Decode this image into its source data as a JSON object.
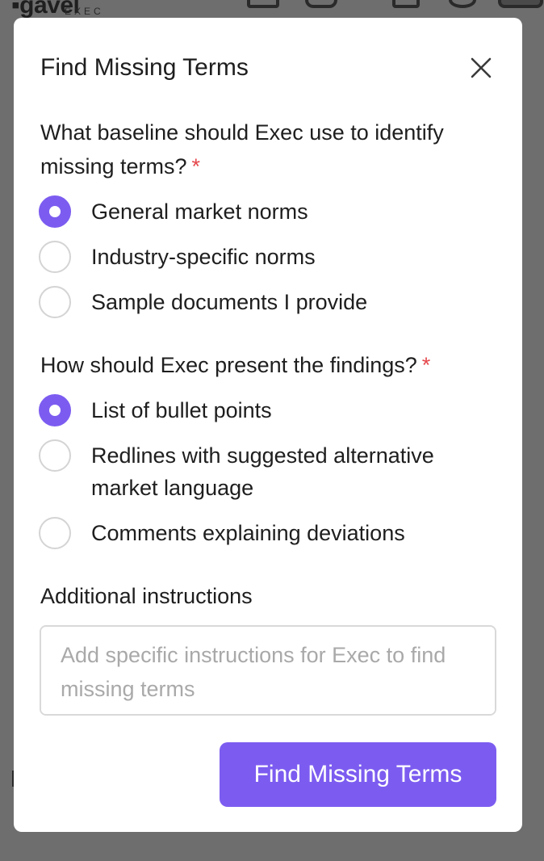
{
  "background": {
    "logo_text": "▪gavel",
    "logo_subtext": "EXEC"
  },
  "modal": {
    "title": "Find Missing Terms",
    "close_icon": "close-icon",
    "required_marker": "*",
    "question_baseline": {
      "label": "What baseline should Exec use to identify missing terms?",
      "options": [
        {
          "label": "General market norms",
          "selected": true
        },
        {
          "label": "Industry-specific norms",
          "selected": false
        },
        {
          "label": "Sample documents I provide",
          "selected": false
        }
      ]
    },
    "question_presentation": {
      "label": "How should Exec present the findings?",
      "options": [
        {
          "label": "List of bullet points",
          "selected": true
        },
        {
          "label": "Redlines with suggested alternative market language",
          "selected": false
        },
        {
          "label": "Comments explaining deviations",
          "selected": false
        }
      ]
    },
    "additional_instructions": {
      "label": "Additional instructions",
      "placeholder": "Add specific instructions for Exec to find missing terms",
      "value": ""
    },
    "submit_label": "Find Missing Terms"
  },
  "colors": {
    "accent": "#7c5cf0",
    "required": "#e5484d",
    "overlay": "#6e6e6e"
  }
}
